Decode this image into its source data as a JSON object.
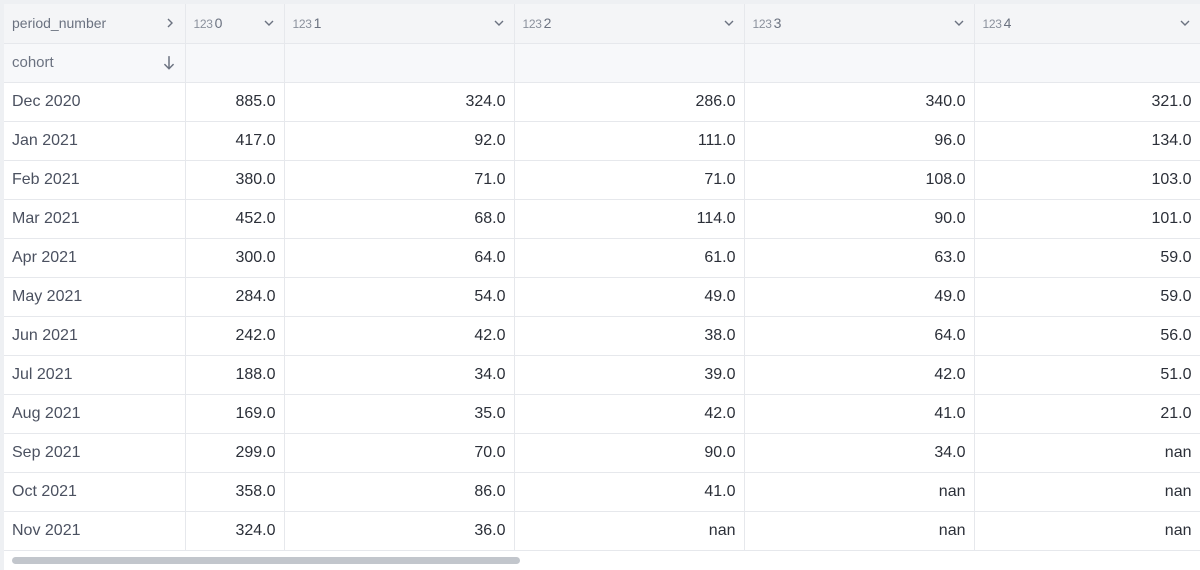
{
  "header": {
    "index_col_label": "period_number",
    "index_expand_icon": "chevron-right-icon",
    "columns": [
      {
        "type": "123",
        "name": "0"
      },
      {
        "type": "123",
        "name": "1"
      },
      {
        "type": "123",
        "name": "2"
      },
      {
        "type": "123",
        "name": "3"
      },
      {
        "type": "123",
        "name": "4"
      }
    ]
  },
  "subheader": {
    "index_name": "cohort",
    "sort_icon": "arrow-down-icon"
  },
  "rows": [
    {
      "cohort": "Dec 2020",
      "values": [
        "885.0",
        "324.0",
        "286.0",
        "340.0",
        "321.0"
      ]
    },
    {
      "cohort": "Jan 2021",
      "values": [
        "417.0",
        "92.0",
        "111.0",
        "96.0",
        "134.0"
      ]
    },
    {
      "cohort": "Feb 2021",
      "values": [
        "380.0",
        "71.0",
        "71.0",
        "108.0",
        "103.0"
      ]
    },
    {
      "cohort": "Mar 2021",
      "values": [
        "452.0",
        "68.0",
        "114.0",
        "90.0",
        "101.0"
      ]
    },
    {
      "cohort": "Apr 2021",
      "values": [
        "300.0",
        "64.0",
        "61.0",
        "63.0",
        "59.0"
      ]
    },
    {
      "cohort": "May 2021",
      "values": [
        "284.0",
        "54.0",
        "49.0",
        "49.0",
        "59.0"
      ]
    },
    {
      "cohort": "Jun 2021",
      "values": [
        "242.0",
        "42.0",
        "38.0",
        "64.0",
        "56.0"
      ]
    },
    {
      "cohort": "Jul 2021",
      "values": [
        "188.0",
        "34.0",
        "39.0",
        "42.0",
        "51.0"
      ]
    },
    {
      "cohort": "Aug 2021",
      "values": [
        "169.0",
        "35.0",
        "42.0",
        "41.0",
        "21.0"
      ]
    },
    {
      "cohort": "Sep 2021",
      "values": [
        "299.0",
        "70.0",
        "90.0",
        "34.0",
        "nan"
      ]
    },
    {
      "cohort": "Oct 2021",
      "values": [
        "358.0",
        "86.0",
        "41.0",
        "nan",
        "nan"
      ]
    },
    {
      "cohort": "Nov 2021",
      "values": [
        "324.0",
        "36.0",
        "nan",
        "nan",
        "nan"
      ]
    }
  ]
}
